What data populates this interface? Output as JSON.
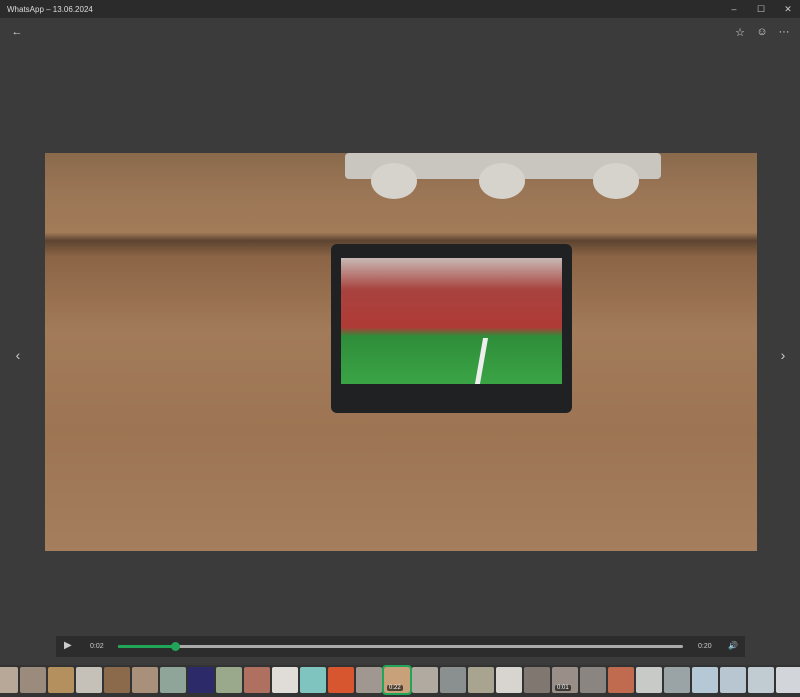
{
  "window": {
    "title": "WhatsApp – 13.06.2024",
    "minimize": "–",
    "maximize": "☐",
    "close": "✕"
  },
  "toolbar": {
    "back": "←",
    "star": "☆",
    "emoji": "☺",
    "more": "···"
  },
  "nav": {
    "prev": "‹",
    "next": "›"
  },
  "player": {
    "play": "▶",
    "current_time": "0:02",
    "duration": "0:20",
    "progress": 0.1,
    "volume": "🔊"
  },
  "accent": "#21a657",
  "thumbnails": [
    {
      "c": "#b8a898"
    },
    {
      "c": "#9a8b7d"
    },
    {
      "c": "#b4905e"
    },
    {
      "c": "#c5c0b8"
    },
    {
      "c": "#8a6a4a"
    },
    {
      "c": "#a8907a"
    },
    {
      "c": "#8fa59a"
    },
    {
      "c": "#2d2a6a"
    },
    {
      "c": "#9aa88c"
    },
    {
      "c": "#b07060"
    },
    {
      "c": "#e0ddd8"
    },
    {
      "c": "#7fc4bf"
    },
    {
      "c": "#d8562f"
    },
    {
      "c": "#a09890"
    },
    {
      "c": "#c8a07a",
      "label": "0:22",
      "selected": true
    },
    {
      "c": "#b0aaa0"
    },
    {
      "c": "#8a9090"
    },
    {
      "c": "#a8a490"
    },
    {
      "c": "#d8d4cf"
    },
    {
      "c": "#807870"
    },
    {
      "c": "#9a8f88",
      "label": "0:01"
    },
    {
      "c": "#8a8580"
    },
    {
      "c": "#c06a50"
    },
    {
      "c": "#c8cac8"
    },
    {
      "c": "#9aa4a6"
    },
    {
      "c": "#b4c8d6"
    },
    {
      "c": "#b8c6d2"
    },
    {
      "c": "#c0ccd2"
    },
    {
      "c": "#d2d6da"
    }
  ]
}
